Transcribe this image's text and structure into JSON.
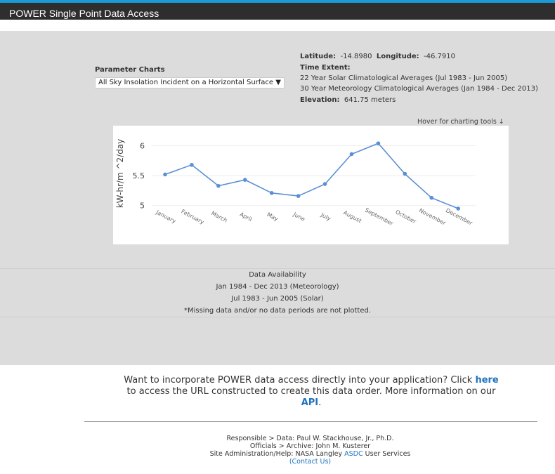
{
  "header": {
    "title": "POWER Single Point Data Access"
  },
  "controls": {
    "param_label": "Parameter Charts",
    "param_selected": "All Sky Insolation Incident on a Horizontal Surface",
    "param_arrow": "▼"
  },
  "info": {
    "lat_label": "Latitude:",
    "lat_value": "-14.8980",
    "lon_label": "Longitude:",
    "lon_value": "-46.7910",
    "time_label": "Time Extent:",
    "solar_extent": "22 Year Solar Climatological Averages (Jul 1983 - Jun 2005)",
    "met_extent": "30 Year Meteorology Climatological Averages (Jan 1984 - Dec 2013)",
    "elev_label": "Elevation:",
    "elev_value": "641.75 meters"
  },
  "hover_hint": "Hover for charting tools ↓",
  "chart_data": {
    "type": "line",
    "title": "",
    "xlabel": "",
    "ylabel": "kW-hr/m ^2/day",
    "categories": [
      "January",
      "February",
      "March",
      "April",
      "May",
      "June",
      "July",
      "August",
      "September",
      "October",
      "November",
      "December"
    ],
    "values": [
      5.52,
      5.68,
      5.33,
      5.43,
      5.21,
      5.16,
      5.36,
      5.86,
      6.04,
      5.53,
      5.13,
      4.95
    ],
    "ylim": [
      4.95,
      6.1
    ],
    "yticks": [
      "5",
      "5.5",
      "6"
    ],
    "grid": true,
    "color": "#5b8fd6"
  },
  "availability": {
    "title": "Data Availability",
    "met": "Jan 1984 - Dec 2013 (Meteorology)",
    "solar": "Jul 1983 - Jun 2005 (Solar)",
    "note": "*Missing data and/or no data periods are not plotted."
  },
  "api": {
    "line1": "Want to incorporate POWER data access directly into your application? Click",
    "here_link": "here",
    "line2": "to access the URL constructed to create this data order. More information on our",
    "api_link": "API",
    "period": "."
  },
  "footer": {
    "responsible": "Responsible > Data: Paul W. Stackhouse, Jr., Ph.D.",
    "officials": "Officials > Archive: John M. Kusterer",
    "site_admin_prefix": "Site Administration/Help: NASA Langley",
    "asdc_link": "ASDC",
    "site_admin_suffix": "User Services",
    "contact_link": "(Contact Us)"
  }
}
